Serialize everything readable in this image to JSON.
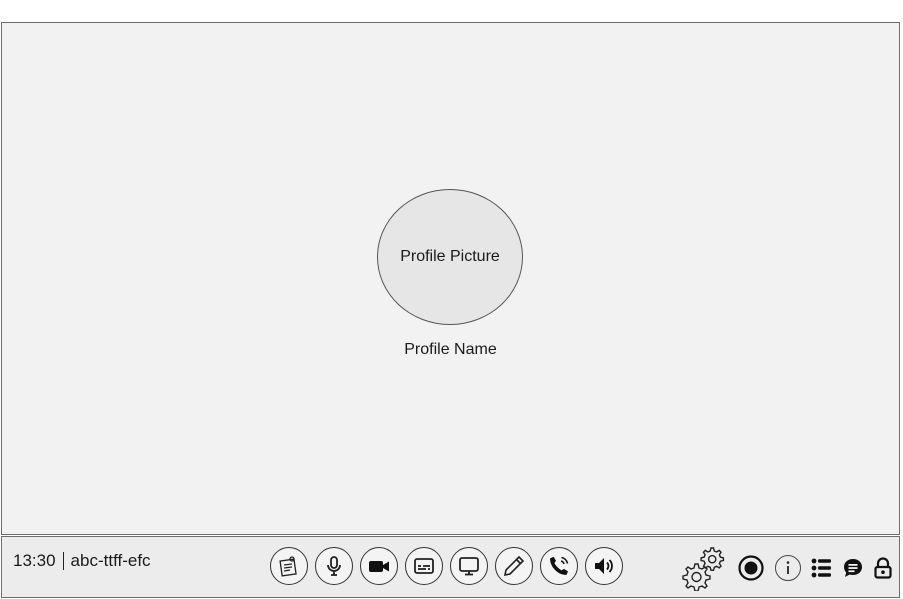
{
  "main": {
    "avatar_label": "Profile Picture",
    "profile_name": "Profile Name"
  },
  "bottom_bar": {
    "time": "13:30",
    "meeting_code": "abc-ttff-efc",
    "center_controls": [
      {
        "name": "notes",
        "icon": "sticky-note-icon"
      },
      {
        "name": "microphone",
        "icon": "microphone-icon"
      },
      {
        "name": "camera",
        "icon": "video-camera-icon"
      },
      {
        "name": "captions",
        "icon": "captions-icon"
      },
      {
        "name": "present-screen",
        "icon": "monitor-icon"
      },
      {
        "name": "whiteboard",
        "icon": "pencil-icon"
      },
      {
        "name": "end-call",
        "icon": "phone-icon"
      },
      {
        "name": "audio",
        "icon": "speaker-icon"
      }
    ],
    "right_controls": [
      {
        "name": "settings",
        "icon": "gears-icon"
      },
      {
        "name": "record",
        "icon": "record-icon"
      },
      {
        "name": "info",
        "icon": "info-icon"
      },
      {
        "name": "participants",
        "icon": "list-icon"
      },
      {
        "name": "chat",
        "icon": "chat-icon"
      },
      {
        "name": "lock",
        "icon": "lock-icon"
      }
    ]
  }
}
